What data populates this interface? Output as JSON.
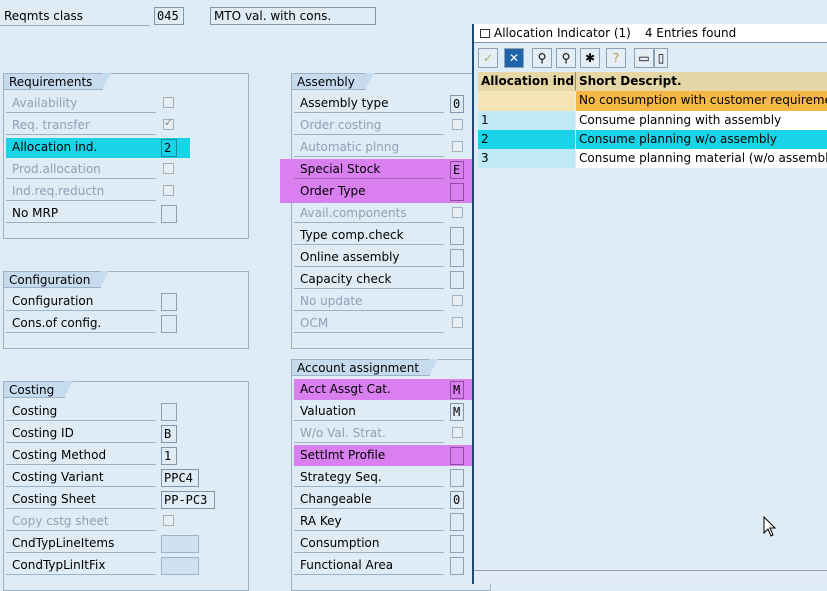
{
  "header": {
    "reqmts_class_label": "Reqmts class",
    "reqmts_class_value": "045",
    "reqmts_class_desc": "MTO val. with cons."
  },
  "requirements": {
    "title": "Requirements",
    "items": [
      {
        "label": "Availability"
      },
      {
        "label": "Req. transfer"
      },
      {
        "label": "Allocation ind.",
        "value": "2"
      },
      {
        "label": "Prod.allocation"
      },
      {
        "label": "Ind.req.reductn"
      },
      {
        "label": "No MRP"
      }
    ]
  },
  "configuration": {
    "title": "Configuration",
    "items": [
      {
        "label": "Configuration"
      },
      {
        "label": "Cons.of config."
      }
    ]
  },
  "costing": {
    "title": "Costing",
    "items": [
      {
        "label": "Costing"
      },
      {
        "label": "Costing ID",
        "value": "B"
      },
      {
        "label": "Costing Method",
        "value": "1"
      },
      {
        "label": "Costing Variant",
        "value": "PPC4"
      },
      {
        "label": "Costing Sheet",
        "value": "PP-PC3"
      },
      {
        "label": "Copy cstg sheet"
      },
      {
        "label": "CndTypLineItems"
      },
      {
        "label": "CondTypLinItFix"
      }
    ]
  },
  "assembly": {
    "title": "Assembly",
    "items": [
      {
        "label": "Assembly type",
        "value": "0"
      },
      {
        "label": "Order costing"
      },
      {
        "label": "Automatic plnng"
      },
      {
        "label": "Special Stock",
        "value": "E"
      },
      {
        "label": "Order Type"
      },
      {
        "label": "Avail.components"
      },
      {
        "label": "Type comp.check"
      },
      {
        "label": "Online assembly"
      },
      {
        "label": "Capacity check"
      },
      {
        "label": "No update"
      },
      {
        "label": "OCM"
      }
    ]
  },
  "account": {
    "title": "Account assignment",
    "items": [
      {
        "label": "Acct Assgt Cat.",
        "value": "M"
      },
      {
        "label": "Valuation",
        "value": "M"
      },
      {
        "label": "W/o Val. Strat."
      },
      {
        "label": "Settlmt Profile"
      },
      {
        "label": "Strategy Seq."
      },
      {
        "label": "Changeable",
        "value": "0"
      },
      {
        "label": "RA Key"
      },
      {
        "label": "Consumption"
      },
      {
        "label": "Functional Area"
      }
    ]
  },
  "popup": {
    "title": "Allocation Indicator (1)",
    "entries_found": "4 Entries found",
    "columns": [
      "Allocation indi",
      "Short Descript."
    ],
    "rows": [
      {
        "key": "",
        "desc": "No consumption with customer requirements"
      },
      {
        "key": "1",
        "desc": "Consume planning with assembly"
      },
      {
        "key": "2",
        "desc": "Consume planning w/o assembly"
      },
      {
        "key": "3",
        "desc": "Consume planning material (w/o assembly)"
      }
    ]
  },
  "colors": {
    "highlight_cyan": "#19d3e6",
    "highlight_magenta": "#d97ff0",
    "selected_row": "#f6b844",
    "alt_row": "#bfe9f7"
  }
}
